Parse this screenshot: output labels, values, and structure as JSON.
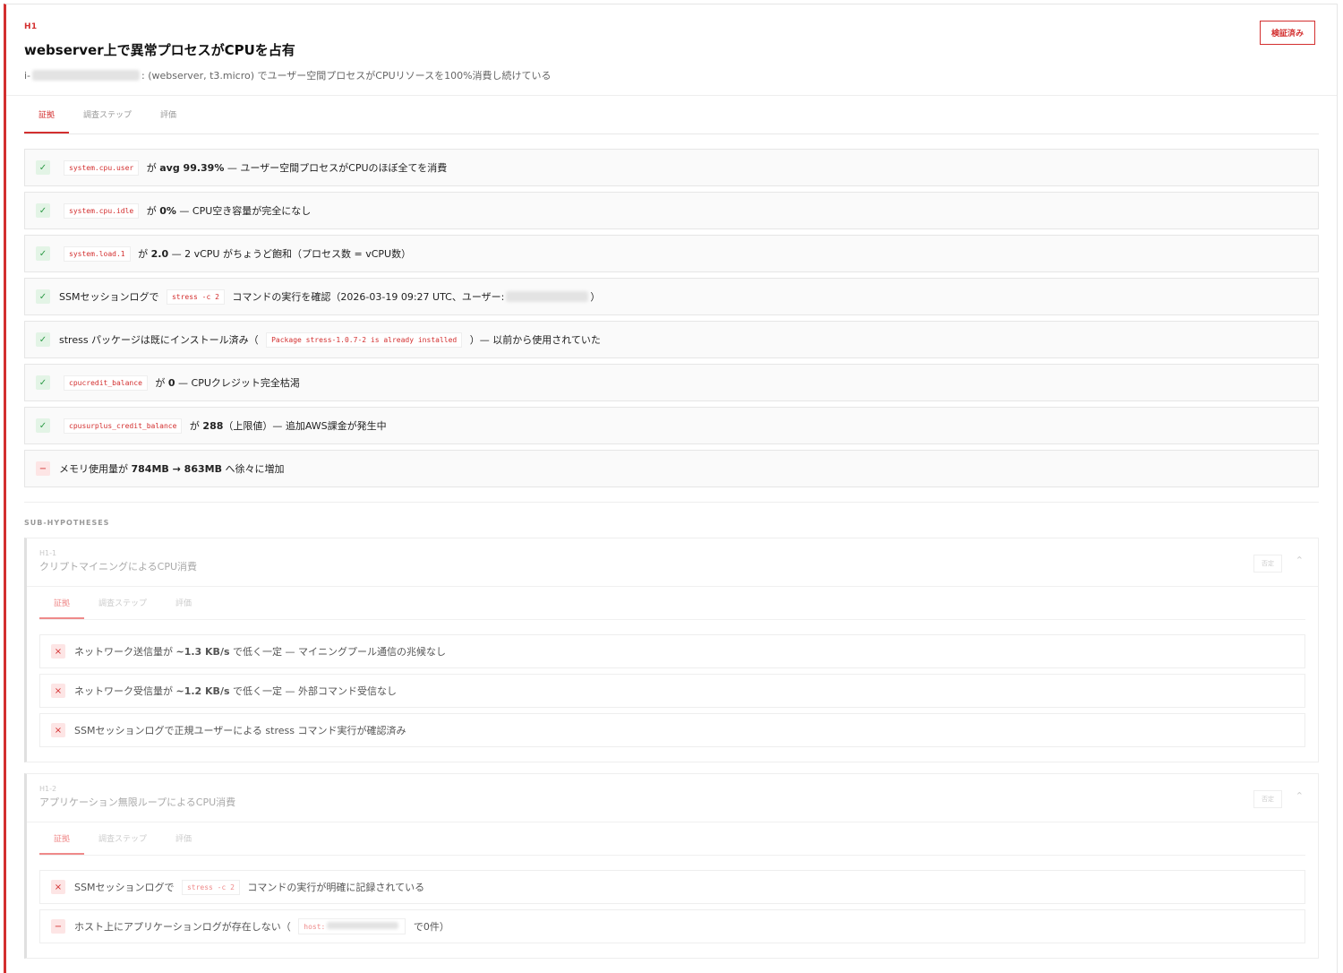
{
  "hypothesis": {
    "id": "H1",
    "title": "webserver上で異常プロセスがCPUを占有",
    "subtitle_prefix": "i-",
    "subtitle_rest": ": (webserver, t3.micro) でユーザー空間プロセスがCPUリソースを100%消費し続けている",
    "status_label": "検証済み",
    "tabs": [
      "証拠",
      "調査ステップ",
      "評価"
    ],
    "evidence": [
      {
        "icon": "✓",
        "pre": "",
        "code": "system.cpu.user",
        "mid": " が ",
        "bold": "avg 99.39%",
        "post": " — ユーザー空間プロセスがCPUのほぼ全てを消費"
      },
      {
        "icon": "✓",
        "pre": "",
        "code": "system.cpu.idle",
        "mid": " が ",
        "bold": "0%",
        "post": " — CPU空き容量が完全になし"
      },
      {
        "icon": "✓",
        "pre": "",
        "code": "system.load.1",
        "mid": " が ",
        "bold": "2.0",
        "post": " — 2 vCPU がちょうど飽和（プロセス数 = vCPU数）"
      },
      {
        "icon": "✓",
        "pre": "SSMセッションログで ",
        "code": "stress -c 2",
        "mid": " コマンドの実行を確認（2026-03-19 09:27 UTC、ユーザー:",
        "bold": "",
        "post": "）"
      },
      {
        "icon": "✓",
        "pre": "stress パッケージは既にインストール済み（ ",
        "code": "Package stress-1.0.7-2 is already installed",
        "mid": " ）— 以前から使用されていた",
        "bold": "",
        "post": ""
      },
      {
        "icon": "✓",
        "pre": "",
        "code": "cpucredit_balance",
        "mid": " が ",
        "bold": "0",
        "post": " — CPUクレジット完全枯渇"
      },
      {
        "icon": "✓",
        "pre": "",
        "code": "cpusurplus_credit_balance",
        "mid": " が ",
        "bold": "288",
        "post": "（上限値）— 追加AWS課金が発生中"
      },
      {
        "icon": "−",
        "pre": "メモリ使用量が ",
        "code": "",
        "mid": "",
        "bold": "784MB → 863MB",
        "post": " へ徐々に増加"
      }
    ]
  },
  "sub_section_label": "SUB-HYPOTHESES",
  "sub_hypotheses": [
    {
      "id": "H1-1",
      "title": "クリプトマイニングによるCPU消費",
      "status_label": "否定",
      "tabs": [
        "証拠",
        "調査ステップ",
        "評価"
      ],
      "evidence": [
        {
          "icon": "×",
          "pre": "ネットワーク送信量が ",
          "code": "",
          "mid": "",
          "bold": "~1.3 KB/s",
          "post": " で低く一定 — マイニングプール通信の兆候なし"
        },
        {
          "icon": "×",
          "pre": "ネットワーク受信量が ",
          "code": "",
          "mid": "",
          "bold": "~1.2 KB/s",
          "post": " で低く一定 — 外部コマンド受信なし"
        },
        {
          "icon": "×",
          "pre": "SSMセッションログで正規ユーザーによる stress コマンド実行が確認済み",
          "code": "",
          "mid": "",
          "bold": "",
          "post": ""
        }
      ]
    },
    {
      "id": "H1-2",
      "title": "アプリケーション無限ループによるCPU消費",
      "status_label": "否定",
      "tabs": [
        "証拠",
        "調査ステップ",
        "評価"
      ],
      "evidence": [
        {
          "icon": "×",
          "pre": "SSMセッションログで ",
          "code": "stress -c 2",
          "mid": " コマンドの実行が明確に記録されている",
          "bold": "",
          "post": ""
        },
        {
          "icon": "−",
          "pre": "ホスト上にアプリケーションログが存在しない（ ",
          "code": "host:",
          "mid": " で0件）",
          "bold": "",
          "post": ""
        }
      ]
    }
  ]
}
